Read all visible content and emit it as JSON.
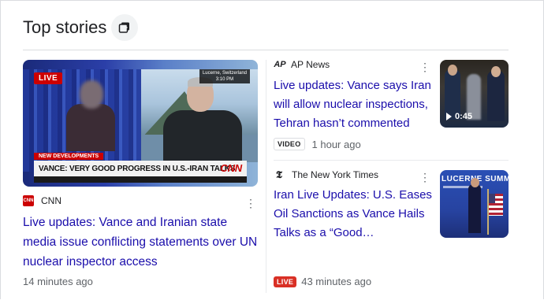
{
  "header": {
    "title": "Top stories",
    "more_icon": "stack-icon"
  },
  "stories": [
    {
      "source": "CNN",
      "source_logo_text": "CNN",
      "headline": "Live updates: Vance and Iranian state media issue conflicting statements over UN nuclear inspector access",
      "time": "14 minutes ago",
      "thumbnail": {
        "live_badge": "LIVE",
        "location": "Lucerne, Switzerland",
        "clock": "3:10 PM",
        "lower_third_tag": "NEW DEVELOPMENTS",
        "chyron": "VANCE: VERY GOOD PROGRESS IN U.S.-IRAN TALKS",
        "network_logo": "CNN"
      }
    },
    {
      "source": "AP News",
      "source_logo_text": "AP",
      "headline": "Live updates: Vance says Iran will allow nuclear inspections, Tehran hasn’t commented",
      "badge": "VIDEO",
      "time": "1 hour ago",
      "thumbnail": {
        "duration": "0:45"
      }
    },
    {
      "source": "The New York Times",
      "source_logo_text": "𝕿",
      "headline": "Iran Live Updates: U.S. Eases Oil Sanctions as Vance Hails Talks as a “Good…",
      "badge": "LIVE",
      "time": "43 minutes ago",
      "thumbnail": {
        "banner": "LUCERNE SUMMIT"
      }
    }
  ],
  "colors": {
    "link": "#1a0dab",
    "live": "#d93025",
    "muted": "#5f6368"
  }
}
